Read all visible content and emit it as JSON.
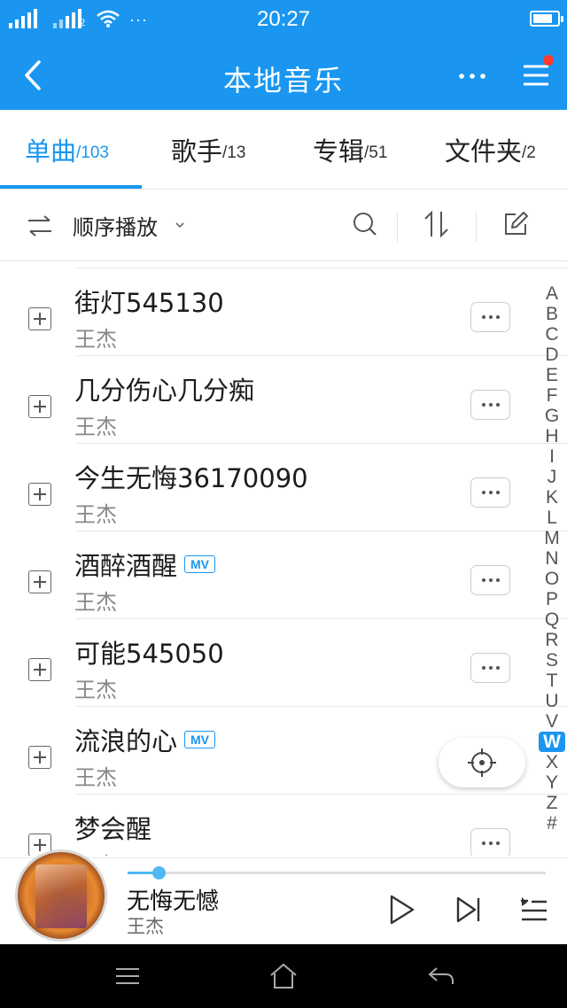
{
  "status_bar": {
    "time": "20:27",
    "sim2_label": "2",
    "more_indicator": "···",
    "battery_level": 0.8
  },
  "header": {
    "title": "本地音乐"
  },
  "tabs": [
    {
      "name": "单曲",
      "count": "/103",
      "active": true
    },
    {
      "name": "歌手",
      "count": "/13"
    },
    {
      "name": "专辑",
      "count": "/51"
    },
    {
      "name": "文件夹",
      "count": "/2"
    }
  ],
  "toolbar": {
    "play_mode": "顺序播放"
  },
  "songs": [
    {
      "title": "街灯545130",
      "artist": "王杰",
      "mv": ""
    },
    {
      "title": "几分伤心几分痴",
      "artist": "王杰",
      "mv": ""
    },
    {
      "title": "今生无悔36170090",
      "artist": "王杰",
      "mv": ""
    },
    {
      "title": "酒醉酒醒",
      "artist": "王杰",
      "mv": "MV"
    },
    {
      "title": "可能545050",
      "artist": "王杰",
      "mv": ""
    },
    {
      "title": "流浪的心",
      "artist": "王杰",
      "mv": "MV"
    },
    {
      "title": "梦会醒",
      "artist": "王杰",
      "mv": ""
    }
  ],
  "alpha_index": {
    "letters": [
      "A",
      "B",
      "C",
      "D",
      "E",
      "F",
      "G",
      "H",
      "I",
      "J",
      "K",
      "L",
      "M",
      "N",
      "O",
      "P",
      "Q",
      "R",
      "S",
      "T",
      "U",
      "V",
      "W",
      "X",
      "Y",
      "Z",
      "#"
    ],
    "active": "W"
  },
  "player": {
    "title": "无悔无憾",
    "artist": "王杰",
    "progress": 0.075
  },
  "colors": {
    "accent": "#1a96f0",
    "notification_dot": "#ff3b30",
    "nav_bar": "#000000"
  },
  "icons": {
    "header": [
      "back-icon",
      "more-icon",
      "menu-icon"
    ],
    "toolbar": [
      "shuffle-icon",
      "chevron-down-icon",
      "search-icon",
      "sort-icon",
      "edit-icon"
    ],
    "player": [
      "play-icon",
      "next-icon",
      "playlist-icon"
    ],
    "nav": [
      "nav-menu-icon",
      "home-icon",
      "back-arrow-icon"
    ],
    "list": [
      "add-icon",
      "more-dots-icon",
      "locate-icon"
    ]
  }
}
